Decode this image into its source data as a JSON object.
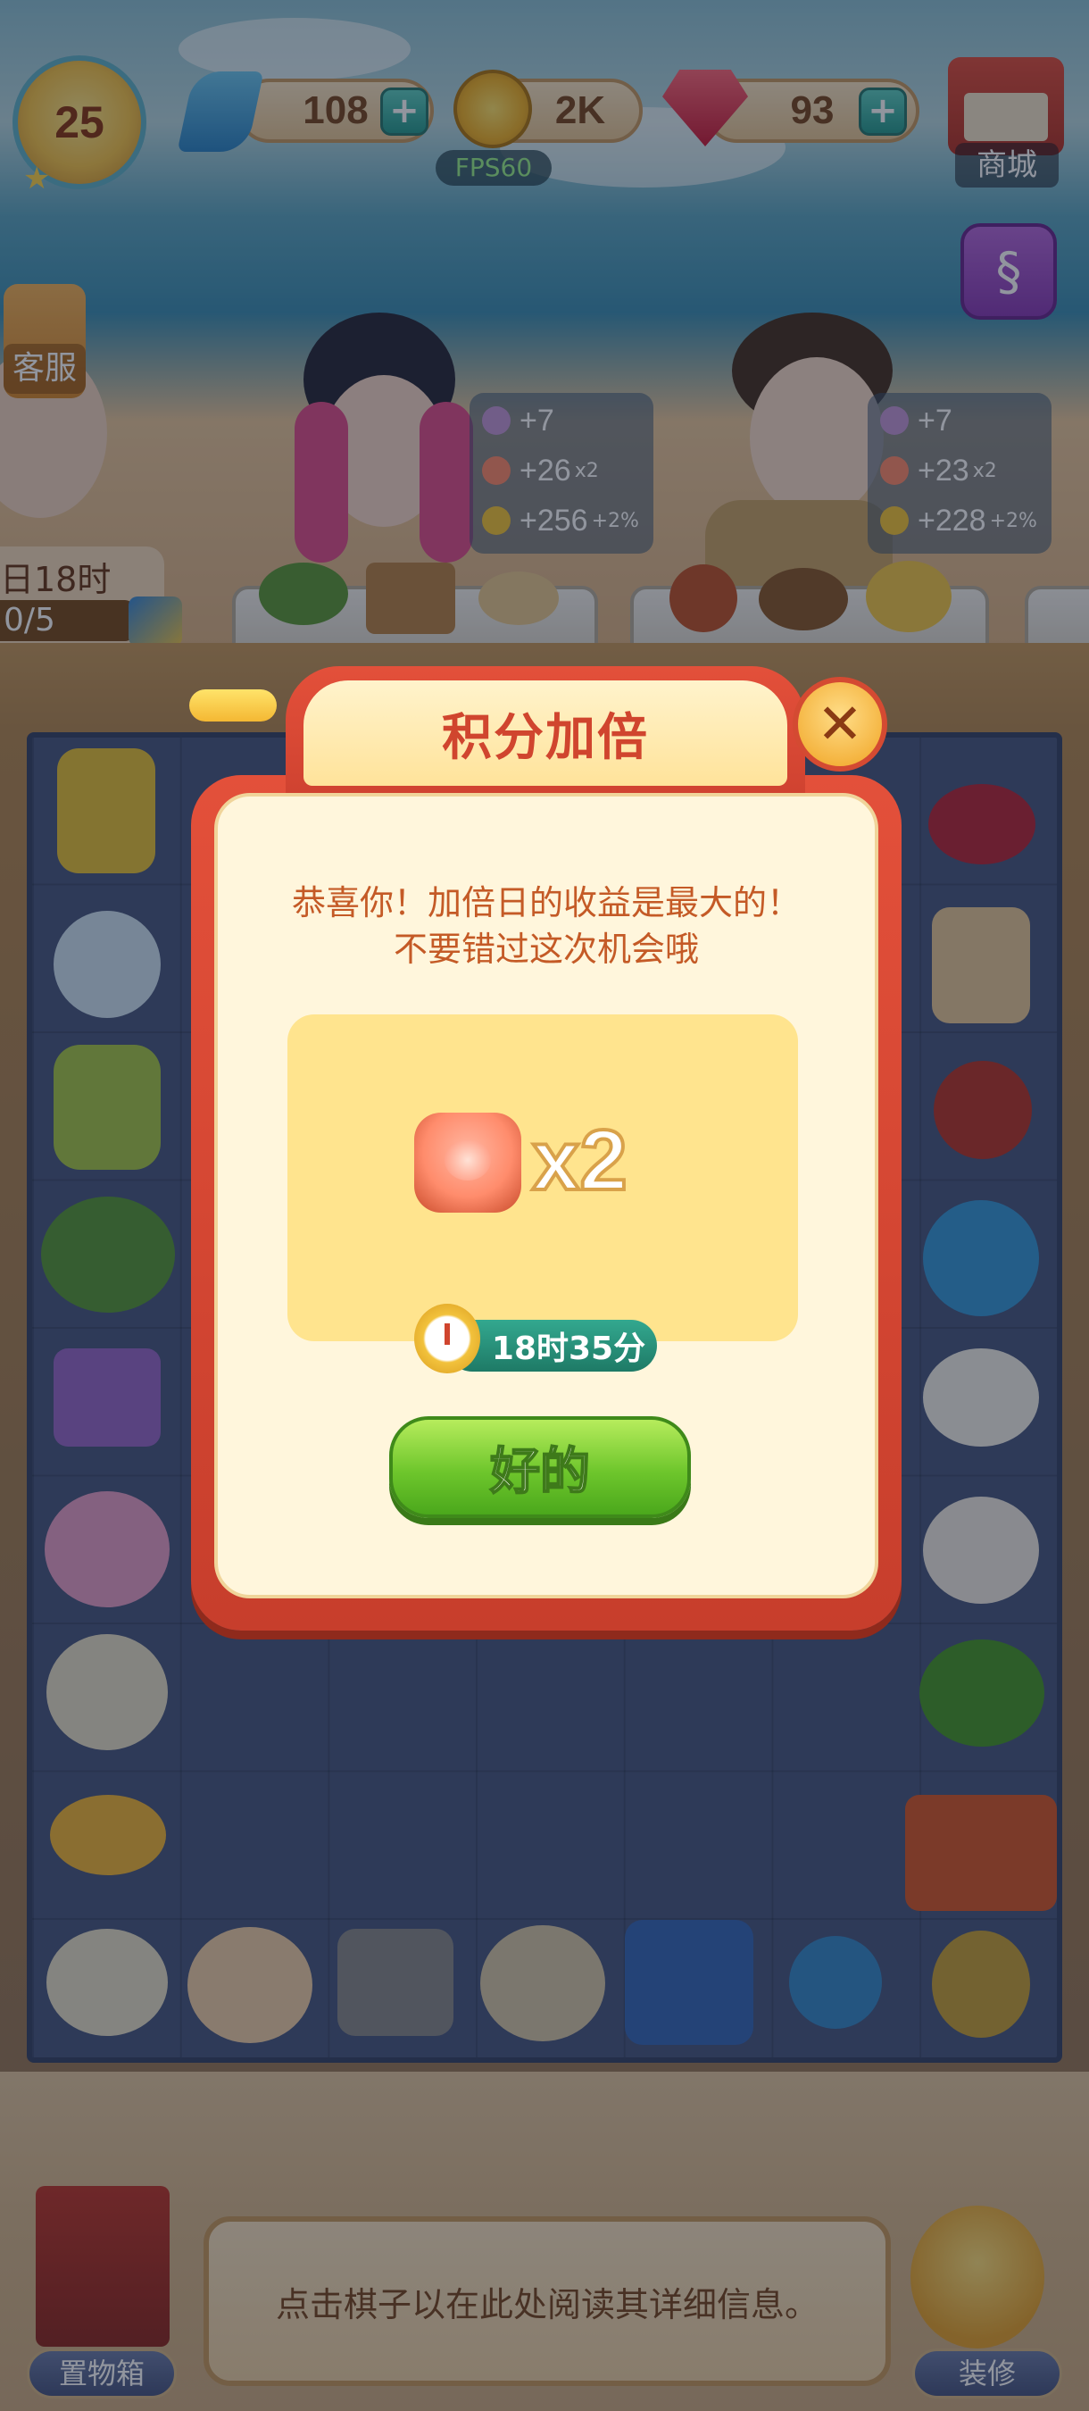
{
  "hud": {
    "level": "25",
    "energy": "108",
    "coins": "2K",
    "gems": "93",
    "fps": "FPS60",
    "shop_label": "商城",
    "service_label": "客服",
    "energy_icon": "lightning-icon",
    "coin_icon": "coin-icon",
    "gem_icon": "ruby-icon"
  },
  "customers": [
    {
      "rewards": [
        {
          "value": "+7"
        },
        {
          "value": "+26",
          "mult": "x2"
        },
        {
          "value": "+256",
          "mult": "+2%"
        }
      ]
    },
    {
      "rewards": [
        {
          "value": "+7"
        },
        {
          "value": "+23",
          "mult": "x2"
        },
        {
          "value": "+228",
          "mult": "+2%"
        }
      ]
    }
  ],
  "left_customer": {
    "timer_text": "日18时",
    "progress_text": "0/5"
  },
  "dialog": {
    "title": "积分加倍",
    "message_line1": "恭喜你！加倍日的收益是最大的！",
    "message_line2": "不要错过这次机会哦",
    "multiplier": "x2",
    "reward_icon": "flower-cake-icon",
    "timer": "18时35分",
    "ok_label": "好的"
  },
  "bottom": {
    "storage_label": "置物箱",
    "info_text": "点击棋子以在此处阅读其详细信息。",
    "decorate_label": "装修"
  },
  "colors": {
    "dialog_red": "#e3503a",
    "dialog_cream": "#fff6dc",
    "reward_yellow": "#ffe48e",
    "ok_green": "#6ec62c",
    "timer_teal": "#1e7a66"
  }
}
